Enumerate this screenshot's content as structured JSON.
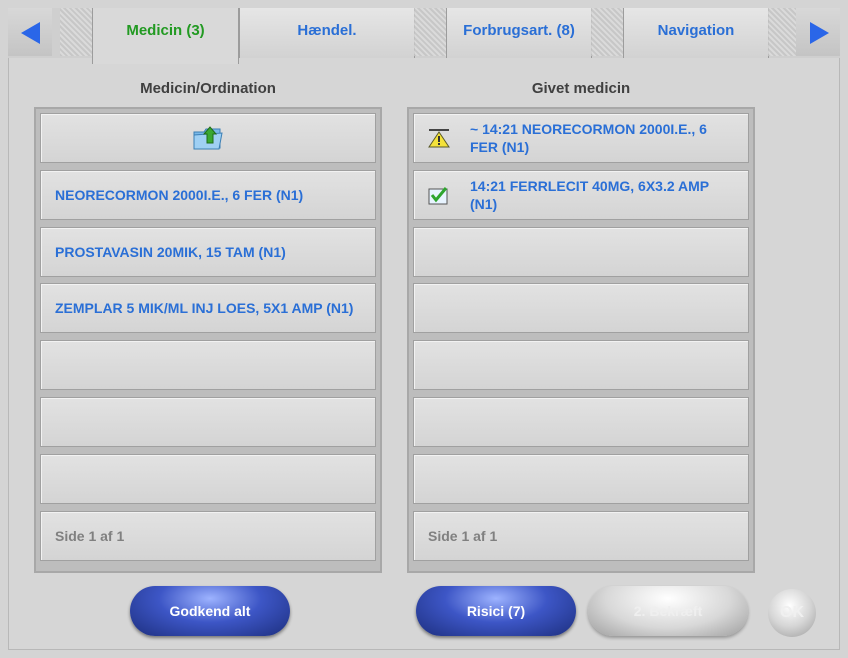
{
  "tabs": {
    "items": [
      {
        "label": "Medicin (3)"
      },
      {
        "label": "Hændel."
      },
      {
        "label": "Forbrugsart. (8)"
      },
      {
        "label": "Navigation"
      }
    ]
  },
  "left": {
    "title": "Medicin/Ordination",
    "items": [
      {
        "label": "NEORECORMON 2000I.E., 6 FER (N1)"
      },
      {
        "label": "PROSTAVASIN 20MIK, 15 TAM (N1)"
      },
      {
        "label": "ZEMPLAR 5 MIK/ML INJ LOES, 5X1 AMP (N1)"
      }
    ],
    "footer": "Side 1 af 1",
    "up_icon": "folder-up-icon"
  },
  "right": {
    "title": "Givet medicin",
    "items": [
      {
        "label": "~ 14:21 NEORECORMON 2000I.E., 6 FER (N1)",
        "icon": "warning-icon"
      },
      {
        "label": "14:21 FERRLECIT 40MG, 6X3.2 AMP (N1)",
        "icon": "checkbox-checked-icon"
      }
    ],
    "footer": "Side 1 af 1"
  },
  "buttons": {
    "approve_all": "Godkend alt",
    "risks": "Risici (7)",
    "confirm2": "2. Bekræft",
    "ok": "OK"
  },
  "colors": {
    "accent": "#2a6fd6",
    "active_tab": "#229a22"
  }
}
